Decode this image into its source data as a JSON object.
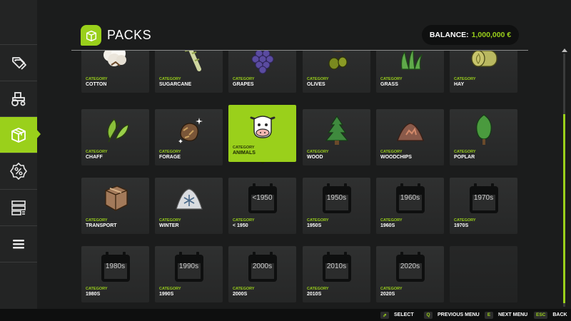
{
  "header": {
    "title": "PACKS",
    "balance_label": "BALANCE:",
    "balance_value": "1,000,000 €"
  },
  "sidebar": {
    "items": [
      {
        "name": "price-tags-icon",
        "active": false
      },
      {
        "name": "tractor-icon",
        "active": false
      },
      {
        "name": "box-icon",
        "active": true
      },
      {
        "name": "percent-icon",
        "active": false
      },
      {
        "name": "server-icon",
        "active": false
      },
      {
        "name": "menu-icon",
        "active": false
      }
    ]
  },
  "category_label": "CATEGORY",
  "selected": "ANIMALS",
  "tiles": [
    {
      "name": "COTTON",
      "icon": "cotton-icon"
    },
    {
      "name": "SUGARCANE",
      "icon": "sugarcane-icon"
    },
    {
      "name": "GRAPES",
      "icon": "grapes-icon"
    },
    {
      "name": "OLIVES",
      "icon": "olives-icon"
    },
    {
      "name": "GRASS",
      "icon": "grass-icon"
    },
    {
      "name": "HAY",
      "icon": "hay-bale-icon"
    },
    {
      "name": "CHAFF",
      "icon": "chaff-icon"
    },
    {
      "name": "FORAGE",
      "icon": "forage-icon"
    },
    {
      "name": "ANIMALS",
      "icon": "cow-icon"
    },
    {
      "name": "WOOD",
      "icon": "pine-tree-icon"
    },
    {
      "name": "WOODCHIPS",
      "icon": "woodchips-icon"
    },
    {
      "name": "POPLAR",
      "icon": "poplar-tree-icon"
    },
    {
      "name": "TRANSPORT",
      "icon": "cardboard-box-icon"
    },
    {
      "name": "WINTER",
      "icon": "snowflake-icon"
    },
    {
      "name": "< 1950",
      "icon": "calendar-icon",
      "calendar": "<1950"
    },
    {
      "name": "1950S",
      "icon": "calendar-icon",
      "calendar": "1950s"
    },
    {
      "name": "1960S",
      "icon": "calendar-icon",
      "calendar": "1960s"
    },
    {
      "name": "1970S",
      "icon": "calendar-icon",
      "calendar": "1970s"
    },
    {
      "name": "1980S",
      "icon": "calendar-icon",
      "calendar": "1980s"
    },
    {
      "name": "1990S",
      "icon": "calendar-icon",
      "calendar": "1990s"
    },
    {
      "name": "2000S",
      "icon": "calendar-icon",
      "calendar": "2000s"
    },
    {
      "name": "2010S",
      "icon": "calendar-icon",
      "calendar": "2010s"
    },
    {
      "name": "2020S",
      "icon": "calendar-icon",
      "calendar": "2020s"
    }
  ],
  "footer": {
    "select_key": "⇗",
    "select_label": "SELECT",
    "prev_key": "Q",
    "prev_label": "PREVIOUS MENU",
    "next_key": "E",
    "next_label": "NEXT MENU",
    "back_key": "ESC",
    "back_label": "BACK"
  },
  "colors": {
    "accent": "#9ad01b",
    "background": "#1b1c1c",
    "tile": "#2b2c2c"
  }
}
